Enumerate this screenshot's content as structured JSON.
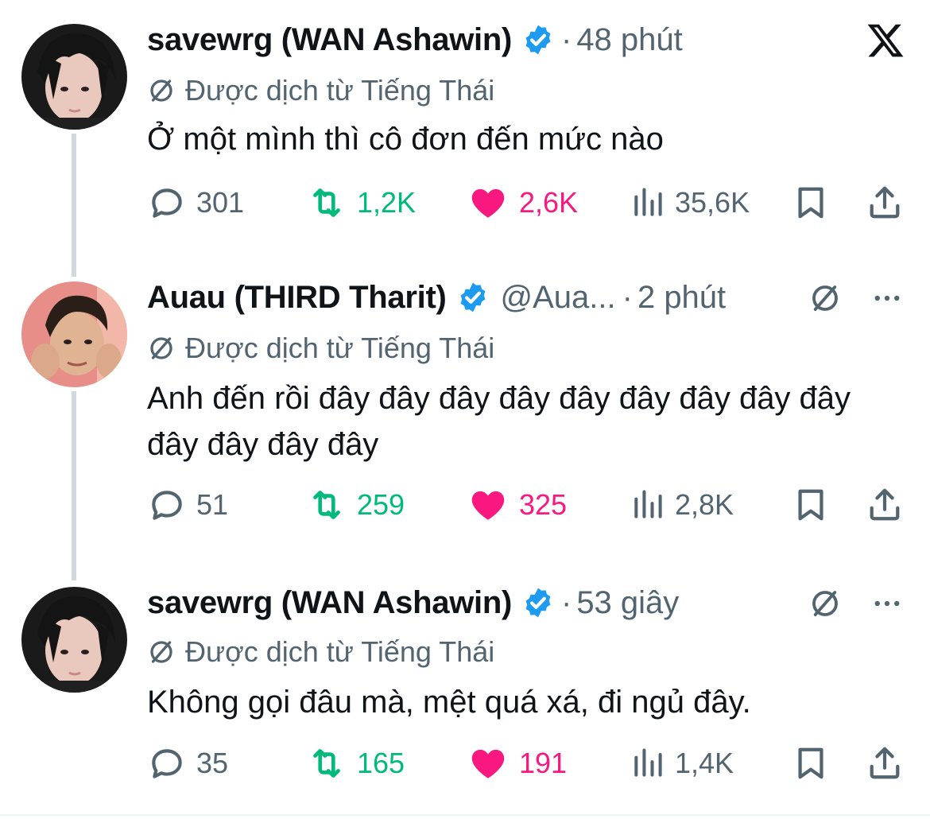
{
  "colors": {
    "verified_blue": "#1d9bf0",
    "secondary_text": "#536471",
    "retweet_green": "#00ba7c",
    "like_pink": "#f91880",
    "thread_line": "#cfd9de"
  },
  "tweets": [
    {
      "name": "savewrg (WAN Ashawin)",
      "verified": true,
      "handle": "",
      "dot": "·",
      "time": "48 phút",
      "translated_label": "Được dịch từ Tiếng Thái",
      "text": "Ở một mình thì cô đơn đến mức nào",
      "replies": "301",
      "retweets": "1,2K",
      "likes": "2,6K",
      "views": "35,6K",
      "liked": true,
      "top_right_icons": [
        "x-logo-icon"
      ]
    },
    {
      "name": "Auau (THIRD Tharit)",
      "verified": true,
      "handle": "@Aua...",
      "dot": "·",
      "time": "2 phút",
      "translated_label": "Được dịch từ Tiếng Thái",
      "text": "Anh đến rồi đây đây đây đây đây đây đây đây đây đây đây đây đây",
      "replies": "51",
      "retweets": "259",
      "likes": "325",
      "views": "2,8K",
      "liked": true,
      "top_right_icons": [
        "translate-icon",
        "more-icon"
      ]
    },
    {
      "name": "savewrg (WAN Ashawin)",
      "verified": true,
      "handle": "",
      "dot": "·",
      "time": "53 giây",
      "translated_label": "Được dịch từ Tiếng Thái",
      "text": "Không gọi đâu mà, mệt quá xá, đi ngủ đây.",
      "replies": "35",
      "retweets": "165",
      "likes": "191",
      "views": "1,4K",
      "liked": true,
      "top_right_icons": [
        "translate-icon",
        "more-icon"
      ]
    }
  ]
}
